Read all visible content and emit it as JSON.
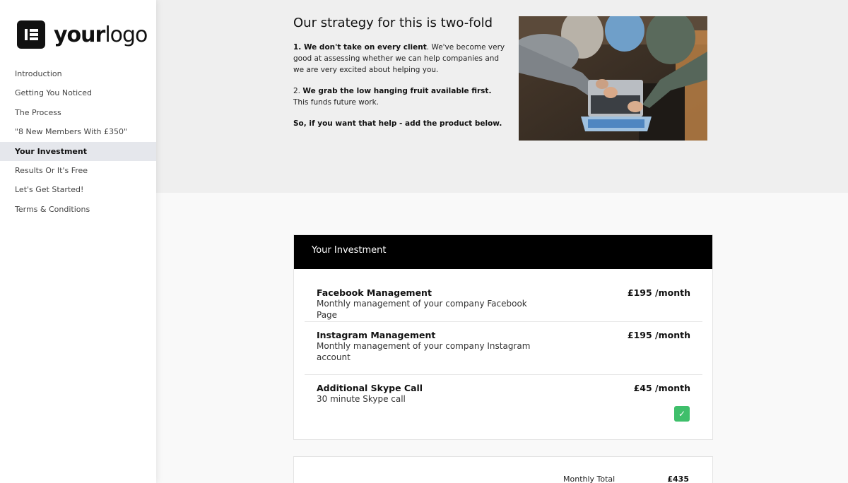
{
  "logo": {
    "icon": "elementor-logo-icon",
    "text_bold": "your",
    "text_rest": "logo"
  },
  "nav": {
    "items": [
      {
        "label": "Introduction"
      },
      {
        "label": "Getting You Noticed"
      },
      {
        "label": "The Process"
      },
      {
        "label": "\"8 New Members With £350\""
      },
      {
        "label": "Your Investment"
      },
      {
        "label": "Results Or It's Free"
      },
      {
        "label": "Let's Get Started!"
      },
      {
        "label": "Terms & Conditions"
      }
    ],
    "active": "Your Investment"
  },
  "hero": {
    "title": "Our strategy for this is two-fold",
    "p1_bold": "1. We don't take on every client",
    "p1_rest": ". We've become very good at assessing whether we can help companies and we are very excited about helping you.",
    "p2_prefix": "2. ",
    "p2_bold": "We grab the low hanging fruit available first.",
    "p2_rest": " This funds future work.",
    "p3_bold": "So, if you want that help - add the product below.",
    "image": "people-around-laptop-photo"
  },
  "investment": {
    "header": "Your Investment",
    "items": [
      {
        "name": "Facebook Management",
        "desc": "Monthly management of your company Facebook Page",
        "price": "£195 /month"
      },
      {
        "name": "Instagram Management",
        "desc": "Monthly management of your company Instagram account",
        "price": "£195 /month"
      },
      {
        "name": "Additional Skype Call",
        "desc": "30 minute Skype call",
        "price": "£45 /month"
      }
    ],
    "optional_selected": true,
    "check_icon": "checkmark-icon",
    "accent": "#3fbf6b"
  },
  "totals": {
    "label": "Monthly Total",
    "value": "£435"
  }
}
